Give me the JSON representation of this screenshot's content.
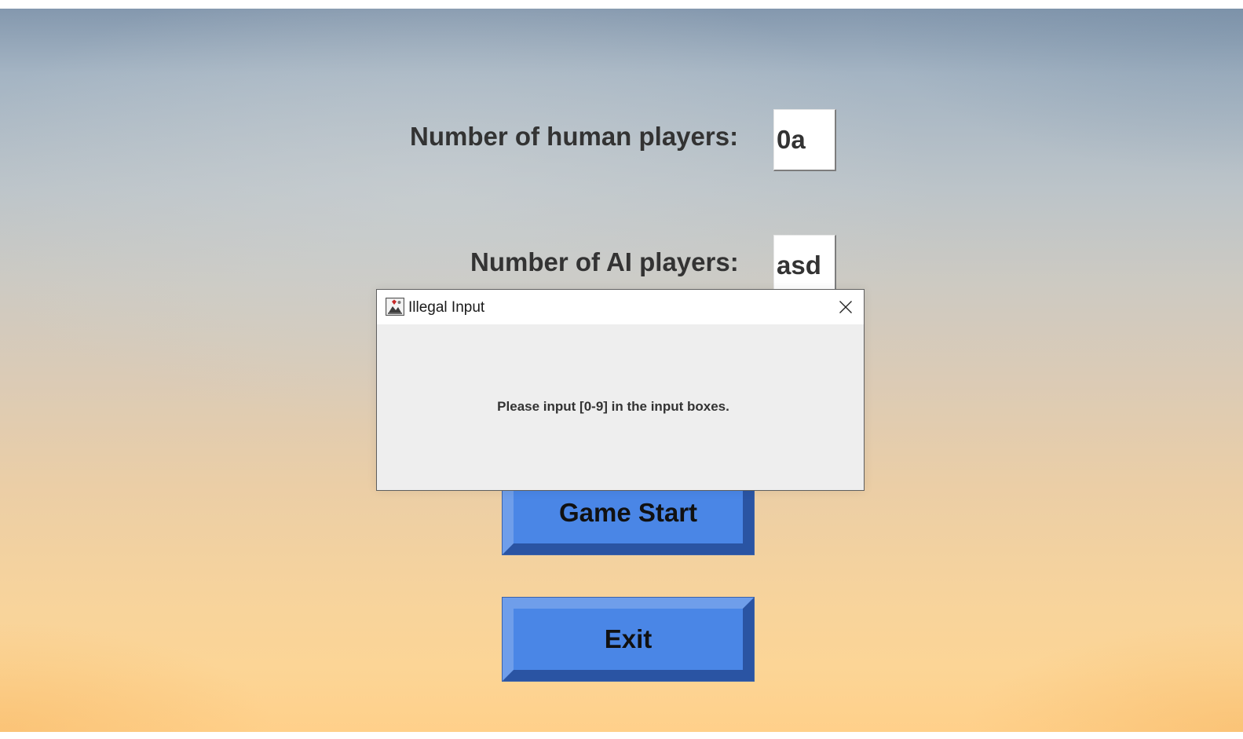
{
  "setup_screen": {
    "human_players_label": "Number of human players:",
    "human_players_value": "0a",
    "ai_players_label": "Number of AI players:",
    "ai_players_value": "asd",
    "game_start_label": "Game Start",
    "exit_label": "Exit",
    "button_color": "#4a86e6"
  },
  "dialog": {
    "icon": "java-app-icon",
    "title": "Illegal Input",
    "close_icon": "close-icon",
    "message": "Please input [0-9] in the input boxes."
  }
}
